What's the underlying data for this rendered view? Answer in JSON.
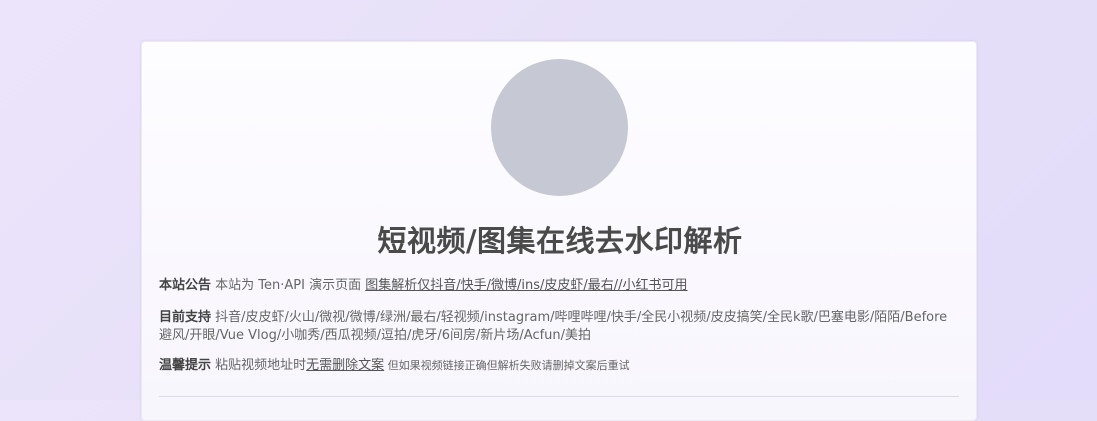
{
  "title": "短视频/图集在线去水印解析",
  "announcement": {
    "label": "本站公告",
    "text": " 本站为 Ten·API 演示页面 ",
    "link": "图集解析仅抖音/快手/微博/ins/皮皮虾/最右//小红书可用"
  },
  "support": {
    "label": "目前支持",
    "text": " 抖音/皮皮虾/火山/微视/微博/绿洲/最右/轻视频/instagram/哔哩哔哩/快手/全民小视频/皮皮搞笑/全民k歌/巴塞电影/陌陌/Before避风/开眼/Vue Vlog/小咖秀/西瓜视频/逗拍/虎牙/6间房/新片场/Acfun/美拍"
  },
  "tip": {
    "label": "温馨提示",
    "text": " 粘贴视频地址时",
    "link": "无需删除文案",
    "note": " 但如果视频链接正确但解析失败请删掉文案后重试"
  },
  "colors": {
    "background": "#e6e0f8",
    "card": "#fbfaff",
    "avatar": "#c6c8d4",
    "title": "#4a4a4a"
  }
}
